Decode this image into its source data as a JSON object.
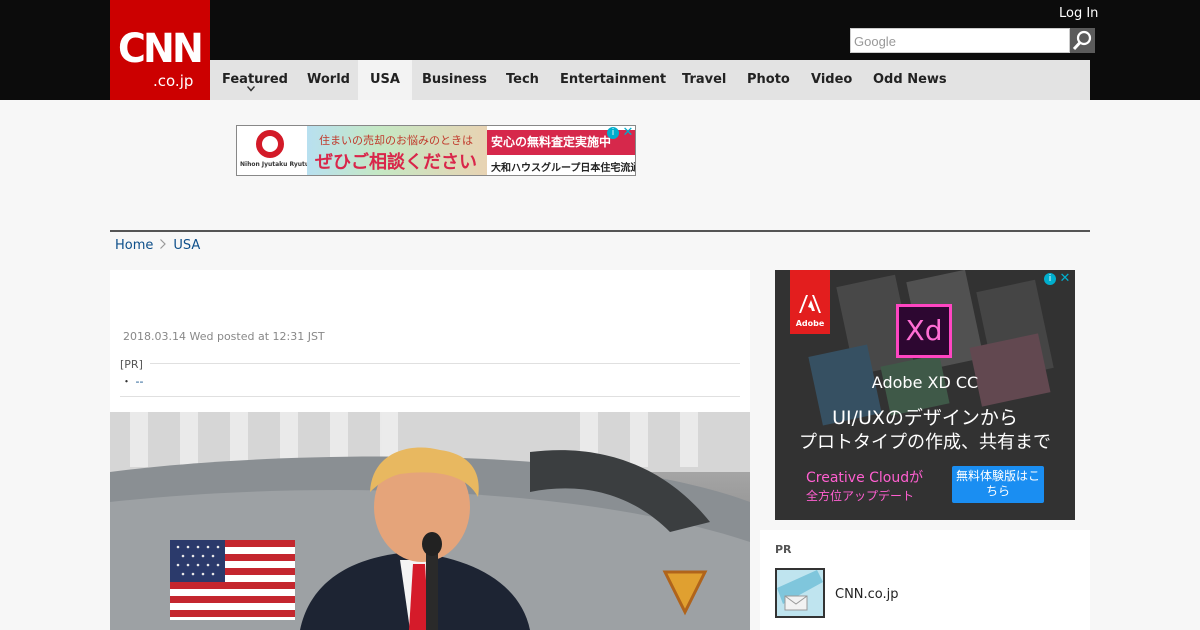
{
  "header": {
    "logo_main": "CNN",
    "logo_sub": ".co.jp",
    "login_label": "Log In",
    "search_placeholder": "Google",
    "search_icon": "magnifier-icon"
  },
  "nav": {
    "items": [
      {
        "label": "Featured"
      },
      {
        "label": "World"
      },
      {
        "label": "USA",
        "active": true
      },
      {
        "label": "Business"
      },
      {
        "label": "Tech"
      },
      {
        "label": "Entertainment"
      },
      {
        "label": "Travel"
      },
      {
        "label": "Photo"
      },
      {
        "label": "Video"
      },
      {
        "label": "Odd News"
      }
    ]
  },
  "ad_top": {
    "brand": "Nihon Jyutaku Ryutu",
    "line1": "住まいの売却のお悩みのときは",
    "line2": "ぜひご相談ください",
    "badge": "安心の無料査定実施中",
    "sub": "大和ハウスグループ日本住宅流通へ"
  },
  "breadcrumb": {
    "home": "Home",
    "section": "USA"
  },
  "article": {
    "date": "2018.03.14 Wed posted at 12:31 JST",
    "pr_label": "[PR]",
    "pr_link": "--"
  },
  "ad_side": {
    "brand": "Adobe",
    "product_badge": "Xd",
    "title": "Adobe XD CC",
    "line1": "UI/UXのデザインから",
    "line2": "プロトタイプの作成、共有まで",
    "cc_line1": "Creative Cloudが",
    "cc_line2": "全方位アップデート",
    "button": "無料体験版はこちら"
  },
  "pr_box": {
    "heading": "PR",
    "item_name": "CNN.co.jp"
  },
  "colors": {
    "brand_red": "#cc0000",
    "header_bg": "#0c0c0c",
    "nav_bg": "#e3e3e3",
    "link": "#0e4f8a"
  }
}
